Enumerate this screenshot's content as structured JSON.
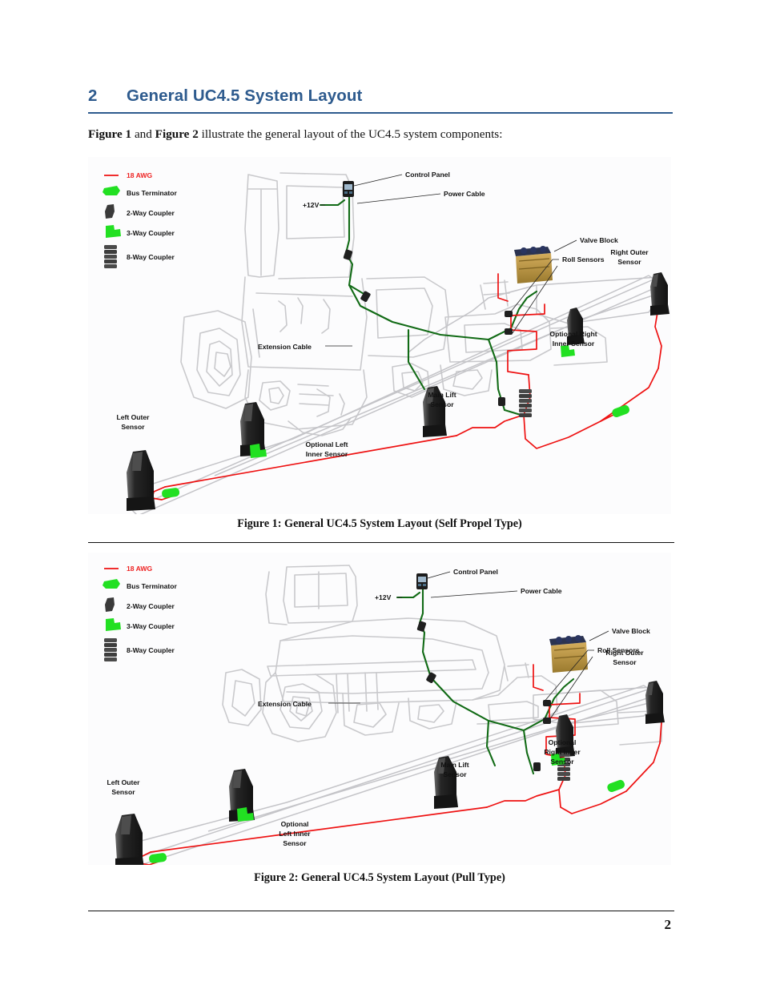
{
  "document": {
    "heading": {
      "number": "2",
      "title": "General UC4.5 System Layout"
    },
    "intro": {
      "figure_ref_1": "Figure 1",
      "conjunction": " and ",
      "figure_ref_2": "Figure 2",
      "rest": " illustrate the general layout of the UC4.5 system components:"
    },
    "page_number": "2"
  },
  "colors": {
    "heading_blue": "#2e5b8e",
    "wire_red": "#ee1111",
    "wire_green": "#126b16",
    "terminator_green": "#22e022",
    "coupler_gray": "#3a3a3a",
    "valve_block_tan": "#b8933e",
    "outline_gray": "#c9c9cc",
    "text_black": "#111111"
  },
  "legend": {
    "items": [
      {
        "label": "18 AWG",
        "icon": "red-line-icon",
        "color": "#ee1111",
        "text_color": "#ee1111"
      },
      {
        "label": "Bus Terminator",
        "icon": "bus-terminator-icon",
        "color": "#22e022",
        "text_color": "#111111"
      },
      {
        "label": "2-Way Coupler",
        "icon": "two-way-coupler-icon",
        "color": "#3a3a3a",
        "text_color": "#111111"
      },
      {
        "label": "3-Way Coupler",
        "icon": "three-way-coupler-icon",
        "color": "#22e022",
        "text_color": "#111111"
      },
      {
        "label": "8-Way Coupler",
        "icon": "eight-way-coupler-icon",
        "color": "#3a3a3a",
        "text_color": "#111111"
      }
    ]
  },
  "figure1": {
    "caption": "Figure 1: General UC4.5 System Layout (Self Propel Type)",
    "type": "Self Propel Type",
    "labels": {
      "control_panel": "Control Panel",
      "power_cable": "Power Cable",
      "voltage": "+12V",
      "valve_block": "Valve Block",
      "roll_sensors": "Roll Sensors",
      "right_outer_sensor_line1": "Right Outer",
      "right_outer_sensor_line2": "Sensor",
      "optional_right_inner_line1": "Optional Right",
      "optional_right_inner_line2": "Inner Sensor",
      "extension_cable": "Extension Cable",
      "main_lift_sensor_line1": "Main Lift",
      "main_lift_sensor_line2": "Sensor",
      "left_outer_sensor_line1": "Left Outer",
      "left_outer_sensor_line2": "Sensor",
      "optional_left_inner_line1": "Optional Left",
      "optional_left_inner_line2": "Inner Sensor"
    }
  },
  "figure2": {
    "caption": "Figure 2: General UC4.5 System Layout (Pull Type)",
    "type": "Pull Type",
    "labels": {
      "control_panel": "Control Panel",
      "power_cable": "Power Cable",
      "voltage": "+12V",
      "valve_block": "Valve Block",
      "roll_sensors": "Roll Sensors",
      "right_outer_sensor_line1": "Right Outer",
      "right_outer_sensor_line2": "Sensor",
      "optional_right_inner_line1": "Optional",
      "optional_right_inner_line2": "Right Inner",
      "optional_right_inner_line3": "Sensor",
      "extension_cable": "Extension Cable",
      "main_lift_sensor_line1": "Main Lift",
      "main_lift_sensor_line2": "Sensor",
      "left_outer_sensor_line1": "Left Outer",
      "left_outer_sensor_line2": "Sensor",
      "optional_left_inner_line1": "Optional",
      "optional_left_inner_line2": "Left Inner",
      "optional_left_inner_line3": "Sensor"
    }
  }
}
